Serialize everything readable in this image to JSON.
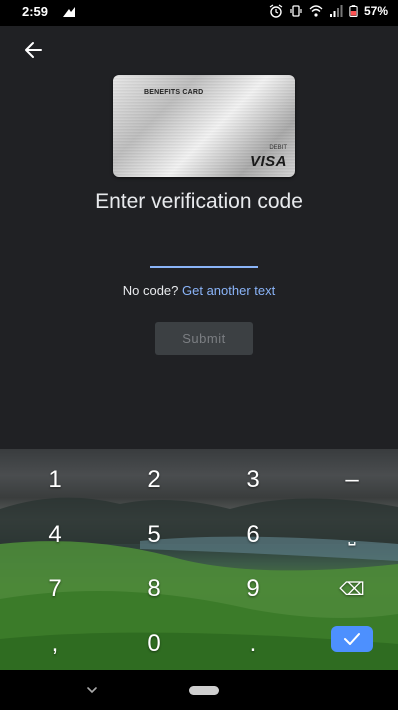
{
  "status_bar": {
    "time": "2:59",
    "battery_percent": "57%"
  },
  "card": {
    "title": "BENEFITS CARD",
    "debit_label": "DEBIT",
    "brand": "VISA"
  },
  "heading": "Enter verification code",
  "code_input": {
    "value": "",
    "placeholder": ""
  },
  "resend": {
    "prompt": "No code?",
    "link": "Get another text"
  },
  "submit_label": "Submit",
  "keyboard": {
    "keys": {
      "k1": "1",
      "k2": "2",
      "k3": "3",
      "minus": "–",
      "k4": "4",
      "k5": "5",
      "k6": "6",
      "space": "⎵",
      "k7": "7",
      "k8": "8",
      "k9": "9",
      "backspace": "⌫",
      "comma": ",",
      "k0": "0",
      "period": "."
    },
    "done_icon": "checkmark-icon"
  },
  "colors": {
    "accent": "#8ab4f8",
    "background": "#202124",
    "done_key": "#4d90fe"
  }
}
